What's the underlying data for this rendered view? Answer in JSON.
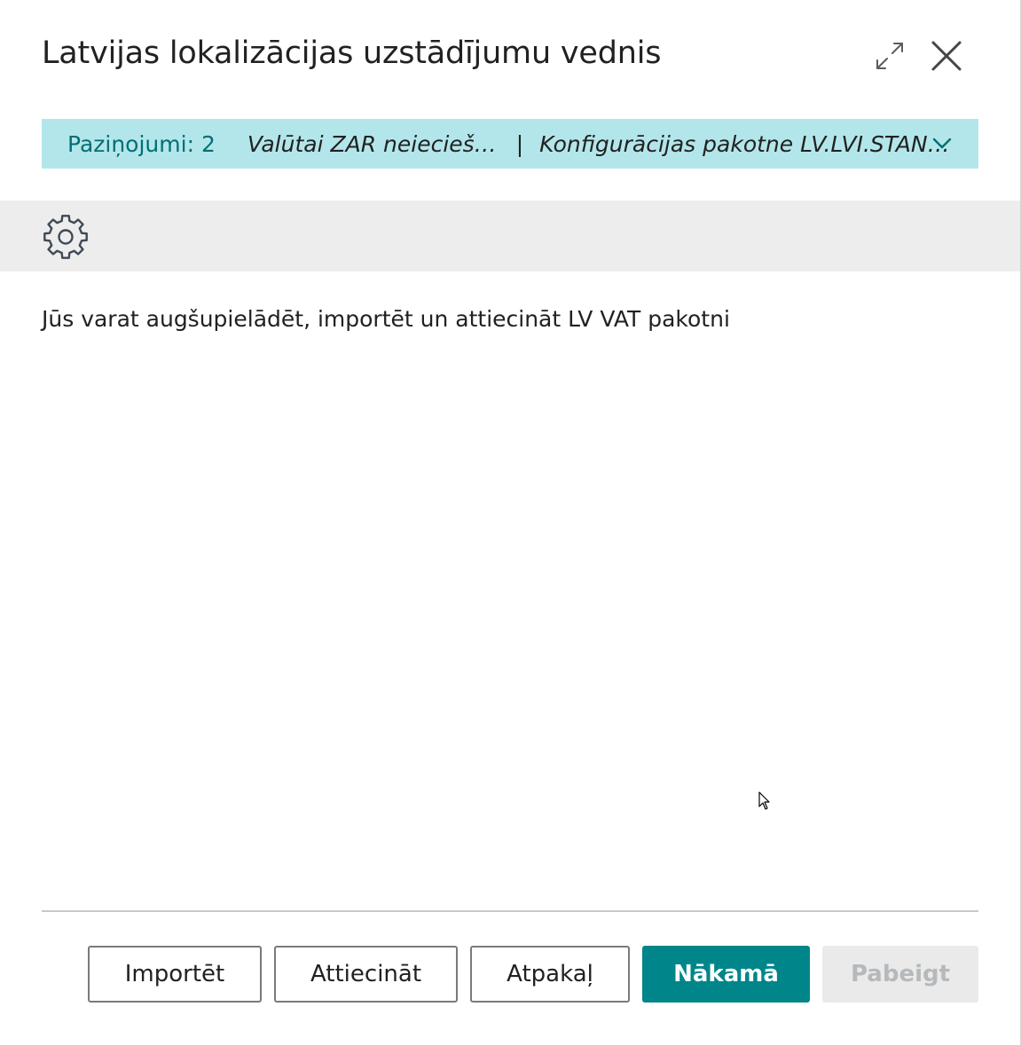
{
  "dialog": {
    "title": "Latvijas lokalizācijas uzstādījumu vednis",
    "expand_icon": "expand-arrows-icon",
    "close_icon": "close-icon"
  },
  "notifications": {
    "count_label": "Paziņojumi: 2",
    "messages": [
      "Valūtai ZAR neiecieš…",
      "Konfigurācijas pakotne LV.LVI.STAN…"
    ],
    "separator": "|",
    "chevron_icon": "chevron-down-icon",
    "background_color": "#b3e6ea",
    "accent_color": "#006f74"
  },
  "banner": {
    "icon": "gear-icon"
  },
  "content": {
    "instruction": "Jūs varat augšupielādēt, importēt un attiecināt LV VAT pakotni"
  },
  "footer": {
    "buttons": {
      "import": "Importēt",
      "apply": "Attiecināt",
      "back": "Atpakaļ",
      "next": "Nākamā",
      "finish": "Pabeigt"
    },
    "primary_color": "#00868a"
  }
}
